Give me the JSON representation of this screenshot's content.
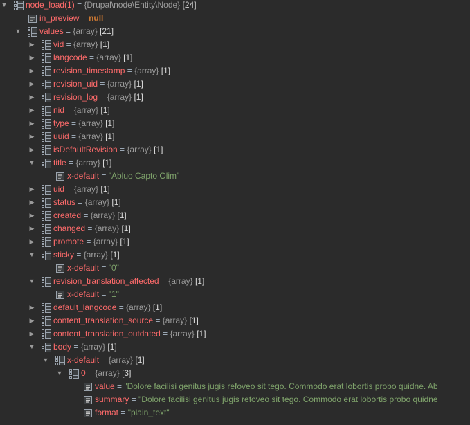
{
  "colors": {
    "background": "#2b2b2b",
    "name": "#ff6b6b",
    "type": "#9b9b9b",
    "string": "#7fa36b",
    "null": "#cc7832",
    "text": "#a9b7c6"
  },
  "rows": [
    {
      "level": 0,
      "toggle": "expanded",
      "icon": "array-icon",
      "name": "node_load(1)",
      "eq": "=",
      "type": "{Drupal\\node\\Entity\\Node}",
      "count": "[24]"
    },
    {
      "level": 1,
      "toggle": "none",
      "icon": "field-icon",
      "name": "in_preview",
      "eq": "=",
      "nullv": "null"
    },
    {
      "level": 1,
      "toggle": "expanded",
      "icon": "array-icon",
      "name": "values",
      "eq": "=",
      "type": "{array}",
      "count": "[21]"
    },
    {
      "level": 2,
      "toggle": "collapsed",
      "icon": "array-icon",
      "name": "vid",
      "eq": "=",
      "type": "{array}",
      "count": "[1]"
    },
    {
      "level": 2,
      "toggle": "collapsed",
      "icon": "array-icon",
      "name": "langcode",
      "eq": "=",
      "type": "{array}",
      "count": "[1]"
    },
    {
      "level": 2,
      "toggle": "collapsed",
      "icon": "array-icon",
      "name": "revision_timestamp",
      "eq": "=",
      "type": "{array}",
      "count": "[1]"
    },
    {
      "level": 2,
      "toggle": "collapsed",
      "icon": "array-icon",
      "name": "revision_uid",
      "eq": "=",
      "type": "{array}",
      "count": "[1]"
    },
    {
      "level": 2,
      "toggle": "collapsed",
      "icon": "array-icon",
      "name": "revision_log",
      "eq": "=",
      "type": "{array}",
      "count": "[1]"
    },
    {
      "level": 2,
      "toggle": "collapsed",
      "icon": "array-icon",
      "name": "nid",
      "eq": "=",
      "type": "{array}",
      "count": "[1]"
    },
    {
      "level": 2,
      "toggle": "collapsed",
      "icon": "array-icon",
      "name": "type",
      "eq": "=",
      "type": "{array}",
      "count": "[1]"
    },
    {
      "level": 2,
      "toggle": "collapsed",
      "icon": "array-icon",
      "name": "uuid",
      "eq": "=",
      "type": "{array}",
      "count": "[1]"
    },
    {
      "level": 2,
      "toggle": "collapsed",
      "icon": "array-icon",
      "name": "isDefaultRevision",
      "eq": "=",
      "type": "{array}",
      "count": "[1]"
    },
    {
      "level": 2,
      "toggle": "expanded",
      "icon": "array-icon",
      "name": "title",
      "eq": "=",
      "type": "{array}",
      "count": "[1]"
    },
    {
      "level": 3,
      "toggle": "none",
      "icon": "field-icon",
      "name": "x-default",
      "eq": "=",
      "str": "\"Abluo Capto Olim\""
    },
    {
      "level": 2,
      "toggle": "collapsed",
      "icon": "array-icon",
      "name": "uid",
      "eq": "=",
      "type": "{array}",
      "count": "[1]"
    },
    {
      "level": 2,
      "toggle": "collapsed",
      "icon": "array-icon",
      "name": "status",
      "eq": "=",
      "type": "{array}",
      "count": "[1]"
    },
    {
      "level": 2,
      "toggle": "collapsed",
      "icon": "array-icon",
      "name": "created",
      "eq": "=",
      "type": "{array}",
      "count": "[1]"
    },
    {
      "level": 2,
      "toggle": "collapsed",
      "icon": "array-icon",
      "name": "changed",
      "eq": "=",
      "type": "{array}",
      "count": "[1]"
    },
    {
      "level": 2,
      "toggle": "collapsed",
      "icon": "array-icon",
      "name": "promote",
      "eq": "=",
      "type": "{array}",
      "count": "[1]"
    },
    {
      "level": 2,
      "toggle": "expanded",
      "icon": "array-icon",
      "name": "sticky",
      "eq": "=",
      "type": "{array}",
      "count": "[1]"
    },
    {
      "level": 3,
      "toggle": "none",
      "icon": "field-icon",
      "name": "x-default",
      "eq": "=",
      "str": "\"0\""
    },
    {
      "level": 2,
      "toggle": "expanded",
      "icon": "array-icon",
      "name": "revision_translation_affected",
      "eq": "=",
      "type": "{array}",
      "count": "[1]"
    },
    {
      "level": 3,
      "toggle": "none",
      "icon": "field-icon",
      "name": "x-default",
      "eq": "=",
      "str": "\"1\""
    },
    {
      "level": 2,
      "toggle": "collapsed",
      "icon": "array-icon",
      "name": "default_langcode",
      "eq": "=",
      "type": "{array}",
      "count": "[1]"
    },
    {
      "level": 2,
      "toggle": "collapsed",
      "icon": "array-icon",
      "name": "content_translation_source",
      "eq": "=",
      "type": "{array}",
      "count": "[1]"
    },
    {
      "level": 2,
      "toggle": "collapsed",
      "icon": "array-icon",
      "name": "content_translation_outdated",
      "eq": "=",
      "type": "{array}",
      "count": "[1]"
    },
    {
      "level": 2,
      "toggle": "expanded",
      "icon": "array-icon",
      "name": "body",
      "eq": "=",
      "type": "{array}",
      "count": "[1]"
    },
    {
      "level": 3,
      "toggle": "expanded",
      "icon": "array-icon",
      "name": "x-default",
      "eq": "=",
      "type": "{array}",
      "count": "[1]"
    },
    {
      "level": 4,
      "toggle": "expanded",
      "icon": "array-icon",
      "name": "0",
      "eq": "=",
      "type": "{array}",
      "count": "[3]"
    },
    {
      "level": 5,
      "toggle": "none",
      "icon": "field-icon",
      "name": "value",
      "eq": "=",
      "str": "\"Dolore facilisi genitus jugis refoveo sit tego. Commodo erat lobortis probo quidne. Ab"
    },
    {
      "level": 5,
      "toggle": "none",
      "icon": "field-icon",
      "name": "summary",
      "eq": "=",
      "str": "\"Dolore facilisi genitus jugis refoveo sit tego. Commodo erat lobortis probo quidne"
    },
    {
      "level": 5,
      "toggle": "none",
      "icon": "field-icon",
      "name": "format",
      "eq": "=",
      "str": "\"plain_text\""
    }
  ]
}
